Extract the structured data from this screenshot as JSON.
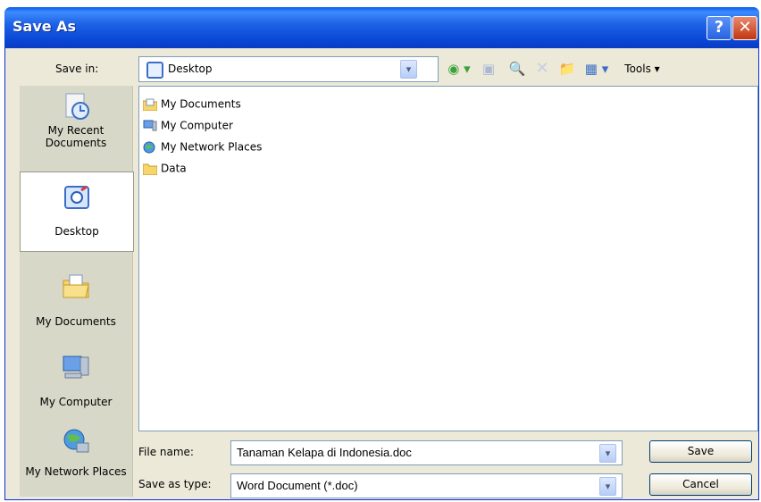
{
  "window": {
    "title": "Save As",
    "help_label": "?",
    "close_label": "✕"
  },
  "toolbar": {
    "save_in_label": "Save in:",
    "location": "Desktop",
    "back_glyph": "◉ ▾",
    "up_glyph": "▣",
    "search_glyph": "🔍",
    "delete_glyph": "✕",
    "new_folder_glyph": "📁",
    "views_glyph": "▦ ▾",
    "tools_label": "Tools ▾",
    "dropdown_glyph": "▾"
  },
  "places": [
    {
      "label": "My Recent Documents",
      "icon": "recent-documents-icon"
    },
    {
      "label": "Desktop",
      "icon": "desktop-icon"
    },
    {
      "label": "My Documents",
      "icon": "my-documents-icon"
    },
    {
      "label": "My Computer",
      "icon": "my-computer-icon"
    },
    {
      "label": "My Network Places",
      "icon": "network-places-icon"
    }
  ],
  "files": [
    {
      "name": "My Documents",
      "icon": "my-documents-icon"
    },
    {
      "name": "My Computer",
      "icon": "my-computer-icon"
    },
    {
      "name": "My Network Places",
      "icon": "network-places-icon"
    },
    {
      "name": "Data",
      "icon": "folder-icon"
    }
  ],
  "form": {
    "file_name_label": "File name:",
    "file_name_value": "Tanaman Kelapa di Indonesia.doc",
    "save_type_label": "Save as type:",
    "save_type_value": "Word Document (*.doc)"
  },
  "buttons": {
    "save": "Save",
    "cancel": "Cancel"
  },
  "colors": {
    "titlebar": "#0a47d6",
    "dialog_bg": "#ece9d8",
    "folder": "#e6b43a"
  }
}
